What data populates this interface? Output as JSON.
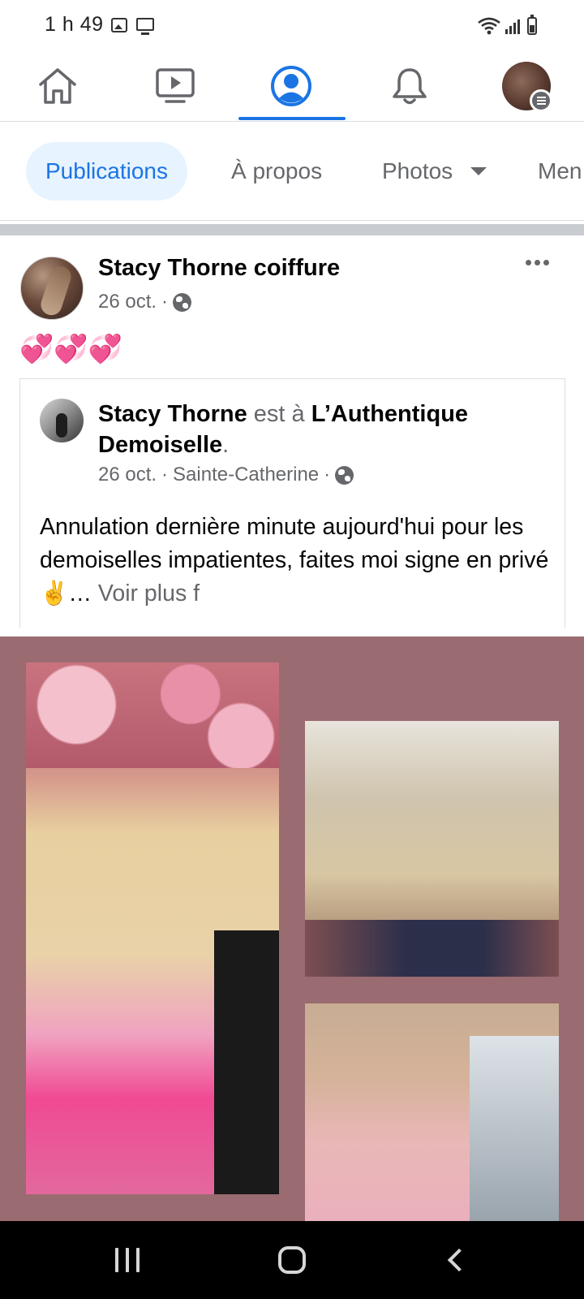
{
  "status_bar": {
    "time": "1 h 49",
    "icons": [
      "image-icon",
      "monitor-icon",
      "wifi-icon",
      "signal-icon",
      "battery-icon"
    ]
  },
  "top_nav": {
    "items": [
      "home-icon",
      "watch-icon",
      "profile-icon",
      "bell-icon",
      "avatar-menu"
    ],
    "active": "profile-icon",
    "accent": "#1b74e4"
  },
  "tabs": [
    {
      "label": "Publications",
      "active": true
    },
    {
      "label": "À propos",
      "active": false
    },
    {
      "label": "Photos",
      "active": false
    },
    {
      "label": "Men",
      "active": false
    }
  ],
  "post": {
    "author": "Stacy Thorne coiffure",
    "date": "26 oct.",
    "separator": "·",
    "text": "💞💞💞",
    "shared": {
      "author": "Stacy Thorne",
      "verb": " est à ",
      "place": "L’Authentique Demoiselle",
      "place_suffix": ".",
      "date": "26 oct.",
      "location": "Sainte-Catherine",
      "separator": "·",
      "text": "Annulation dernière minute aujourd'hui pour les demoiselles impatientes, faites moi signe en privé ✌️… ",
      "see_more": "Voir plus f"
    }
  },
  "collage": {
    "background": "#9a6b70",
    "photos": [
      "hair-photo-pink-ombre",
      "hair-photo-blonde",
      "hair-photo-pastel-pink"
    ]
  },
  "system_nav": [
    "recents-button",
    "home-button",
    "back-button"
  ]
}
